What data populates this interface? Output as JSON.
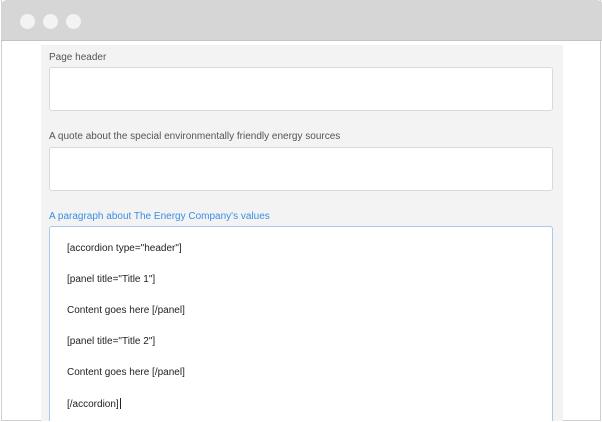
{
  "window": {
    "controls": [
      "close",
      "minimize",
      "maximize"
    ]
  },
  "form": {
    "fields": [
      {
        "label": "Page header",
        "value": ""
      },
      {
        "label": "A quote about the special environmentally friendly energy sources",
        "value": ""
      },
      {
        "label": "A paragraph about The Energy Company's values",
        "active": true
      }
    ],
    "paragraph_lines": [
      "[accordion type=\"header\"]",
      "[panel title=\"Title 1\"]",
      "Content goes here [/panel]",
      "[panel title=\"Title 2\"]",
      "Content goes here [/panel]",
      "[/accordion]"
    ]
  },
  "colors": {
    "active_label": "#3a8ee6",
    "panel_background": "#f3f3f3",
    "titlebar": "#d6d6d6"
  }
}
